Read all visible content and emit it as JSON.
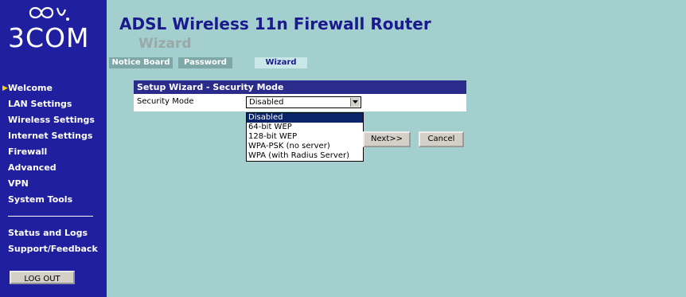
{
  "brand": {
    "logo_text": "3COM"
  },
  "header": {
    "title": "ADSL Wireless 11n Firewall Router",
    "subtitle": "Wizard"
  },
  "tabs": [
    {
      "label": "Notice Board",
      "active": false
    },
    {
      "label": "Password",
      "active": false
    },
    {
      "label": "Wizard",
      "active": true
    }
  ],
  "sidebar": {
    "items": [
      {
        "label": "Welcome",
        "current": true
      },
      {
        "label": "LAN Settings"
      },
      {
        "label": "Wireless Settings"
      },
      {
        "label": "Internet Settings"
      },
      {
        "label": "Firewall"
      },
      {
        "label": "Advanced"
      },
      {
        "label": "VPN"
      },
      {
        "label": "System Tools"
      },
      {
        "label": "Status and Logs"
      },
      {
        "label": "Support/Feedback"
      }
    ],
    "logout_label": "LOG OUT"
  },
  "wizard": {
    "panel_title": "Setup Wizard - Security Mode",
    "security_mode_label": "Security Mode",
    "security_mode_value": "Disabled",
    "options": [
      "Disabled",
      "64-bit WEP",
      "128-bit WEP",
      "WPA-PSK (no server)",
      "WPA (with Radius Server)"
    ],
    "next_label": "Next>>",
    "cancel_label": "Cancel"
  },
  "colors": {
    "sidebar_bg": "#1f1fa0",
    "page_bg": "#a3cfcf",
    "title": "#1a1a8c",
    "selection": "#0a246a"
  }
}
